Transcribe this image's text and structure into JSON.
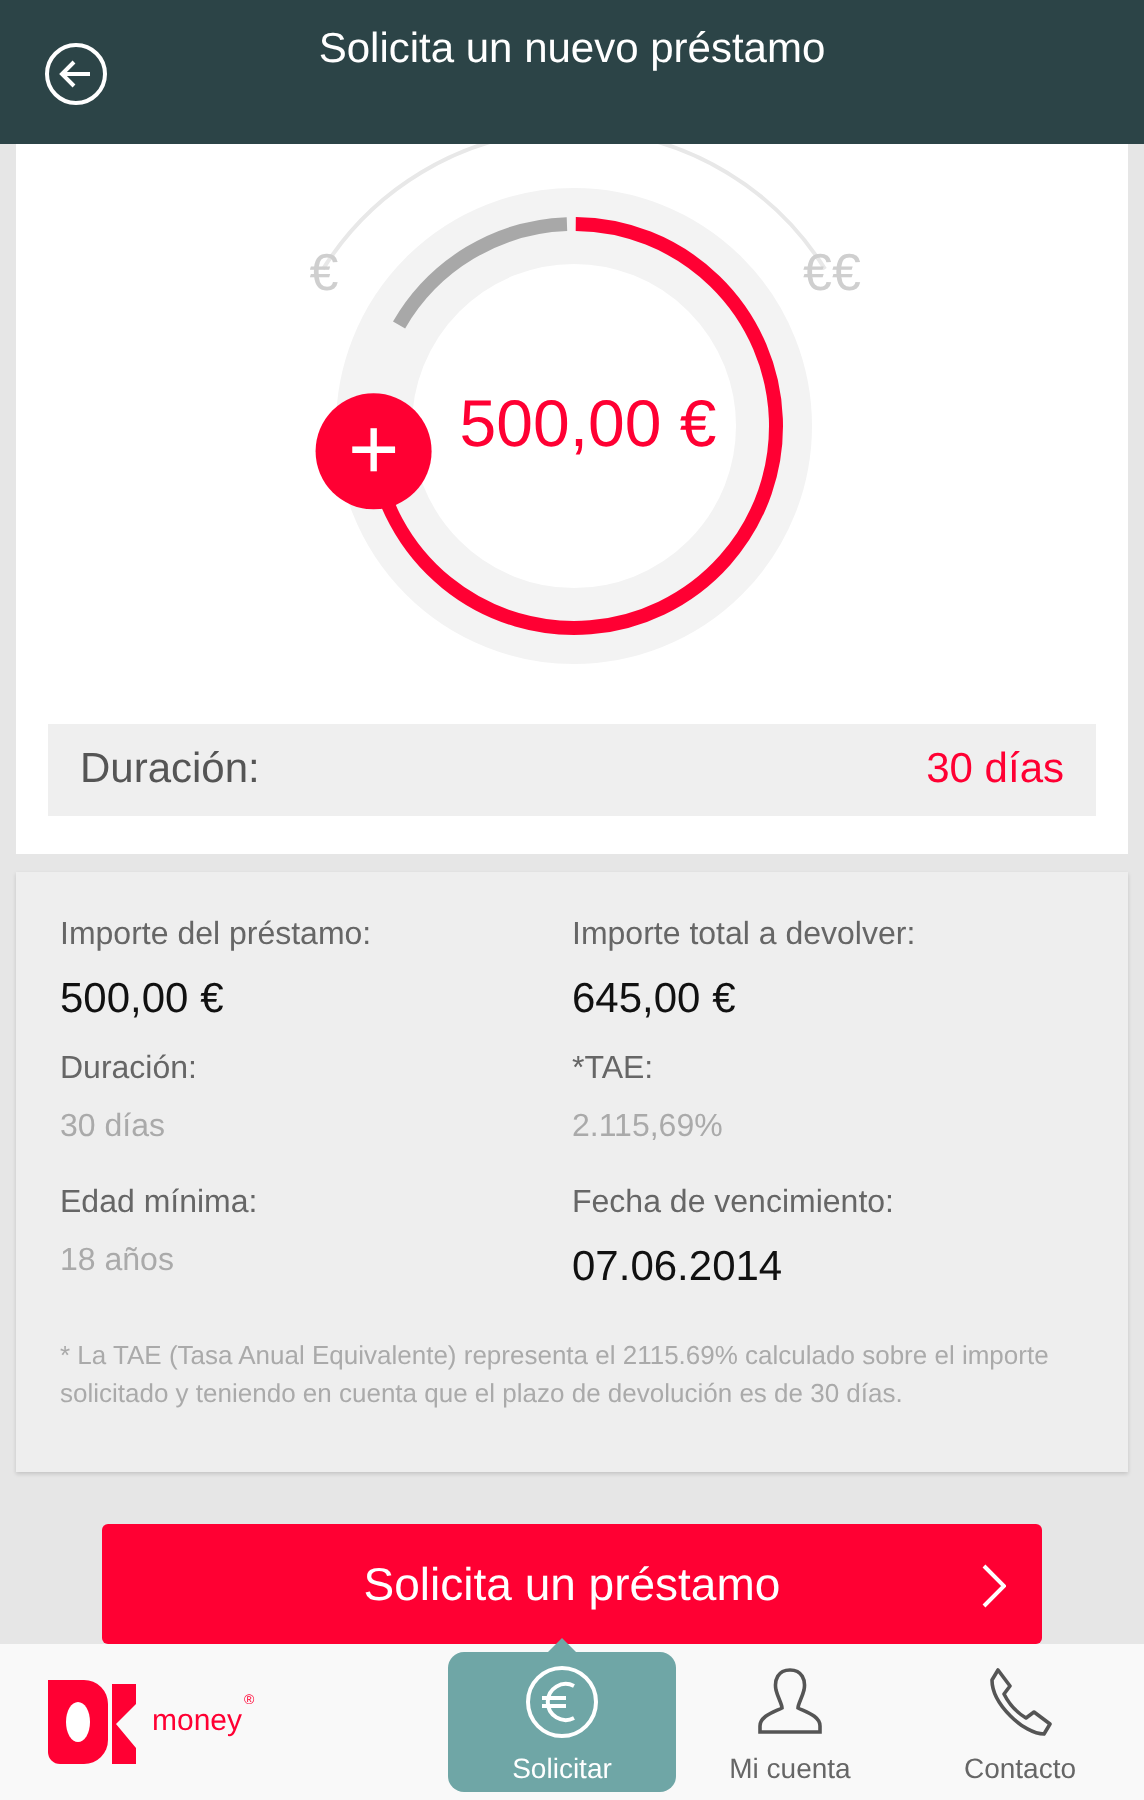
{
  "header": {
    "title": "Solicita un nuevo préstamo"
  },
  "dial": {
    "min_label": "€",
    "max_label": "€€",
    "amount": "500,00 €",
    "handle": "+"
  },
  "duration": {
    "label": "Duración:",
    "value": "30 días"
  },
  "details": [
    {
      "label": "Importe del préstamo:",
      "value": "500,00 €",
      "kind": "emphasis"
    },
    {
      "label": "Importe total a devolver:",
      "value": "645,00 €",
      "kind": "emphasis"
    },
    {
      "label": "Duración:",
      "value": "30 días",
      "kind": "muted"
    },
    {
      "label": "*TAE:",
      "value": "2.115,69%",
      "kind": "muted"
    },
    {
      "label": "Edad mínima:",
      "value": "18 años",
      "kind": "muted"
    },
    {
      "label": "Fecha de vencimiento:",
      "value": "07.06.2014",
      "kind": "emphasis"
    }
  ],
  "footnote": "* La TAE (Tasa Anual Equivalente) representa el 2115.69% calculado sobre el importe solicitado y teniendo en cuenta que el plazo de devolución es de 30 días.",
  "cta": {
    "label": "Solicita un préstamo"
  },
  "bottom_nav": {
    "logo_text": "money",
    "logo_mark": "®",
    "items": [
      {
        "label": "Solicitar",
        "selected": true
      },
      {
        "label": "Mi cuenta",
        "selected": false
      },
      {
        "label": "Contacto",
        "selected": false
      }
    ]
  }
}
